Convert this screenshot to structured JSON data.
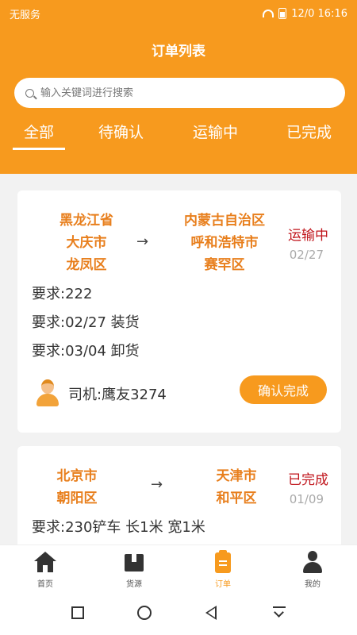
{
  "statusbar": {
    "carrier": "无服务",
    "time_text": "12/0 16:16"
  },
  "header": {
    "title": "订单列表"
  },
  "search": {
    "placeholder": "输入关键词进行搜索"
  },
  "tabs": [
    {
      "label": "全部",
      "active": true
    },
    {
      "label": "待确认",
      "active": false
    },
    {
      "label": "运输中",
      "active": false
    },
    {
      "label": "已完成",
      "active": false
    }
  ],
  "orders": [
    {
      "from": [
        "黑龙江省",
        "大庆市",
        "龙凤区"
      ],
      "to": [
        "内蒙古自治区",
        "呼和浩特市",
        "赛罕区"
      ],
      "arrow": "→",
      "status": "运输中",
      "date": "02/27",
      "requirements": [
        "要求:222",
        "要求:02/27 装货",
        "要求:03/04 卸货"
      ],
      "driver": "司机:鹰友3274",
      "action": "确认完成"
    },
    {
      "from": [
        "北京市",
        "朝阳区"
      ],
      "to": [
        "天津市",
        "和平区"
      ],
      "arrow": "→",
      "status": "已完成",
      "date": "01/09",
      "requirements": [
        "要求:230铲车 长1米 宽1米"
      ]
    }
  ],
  "bottom_nav": [
    {
      "label": "首页",
      "icon": "home-icon"
    },
    {
      "label": "货源",
      "icon": "box-icon"
    },
    {
      "label": "订单",
      "icon": "order-icon",
      "active": true
    },
    {
      "label": "我的",
      "icon": "user-icon"
    }
  ],
  "colors": {
    "accent": "#f79a1e",
    "status_red": "#c0141b",
    "location": "#e87f1d"
  }
}
